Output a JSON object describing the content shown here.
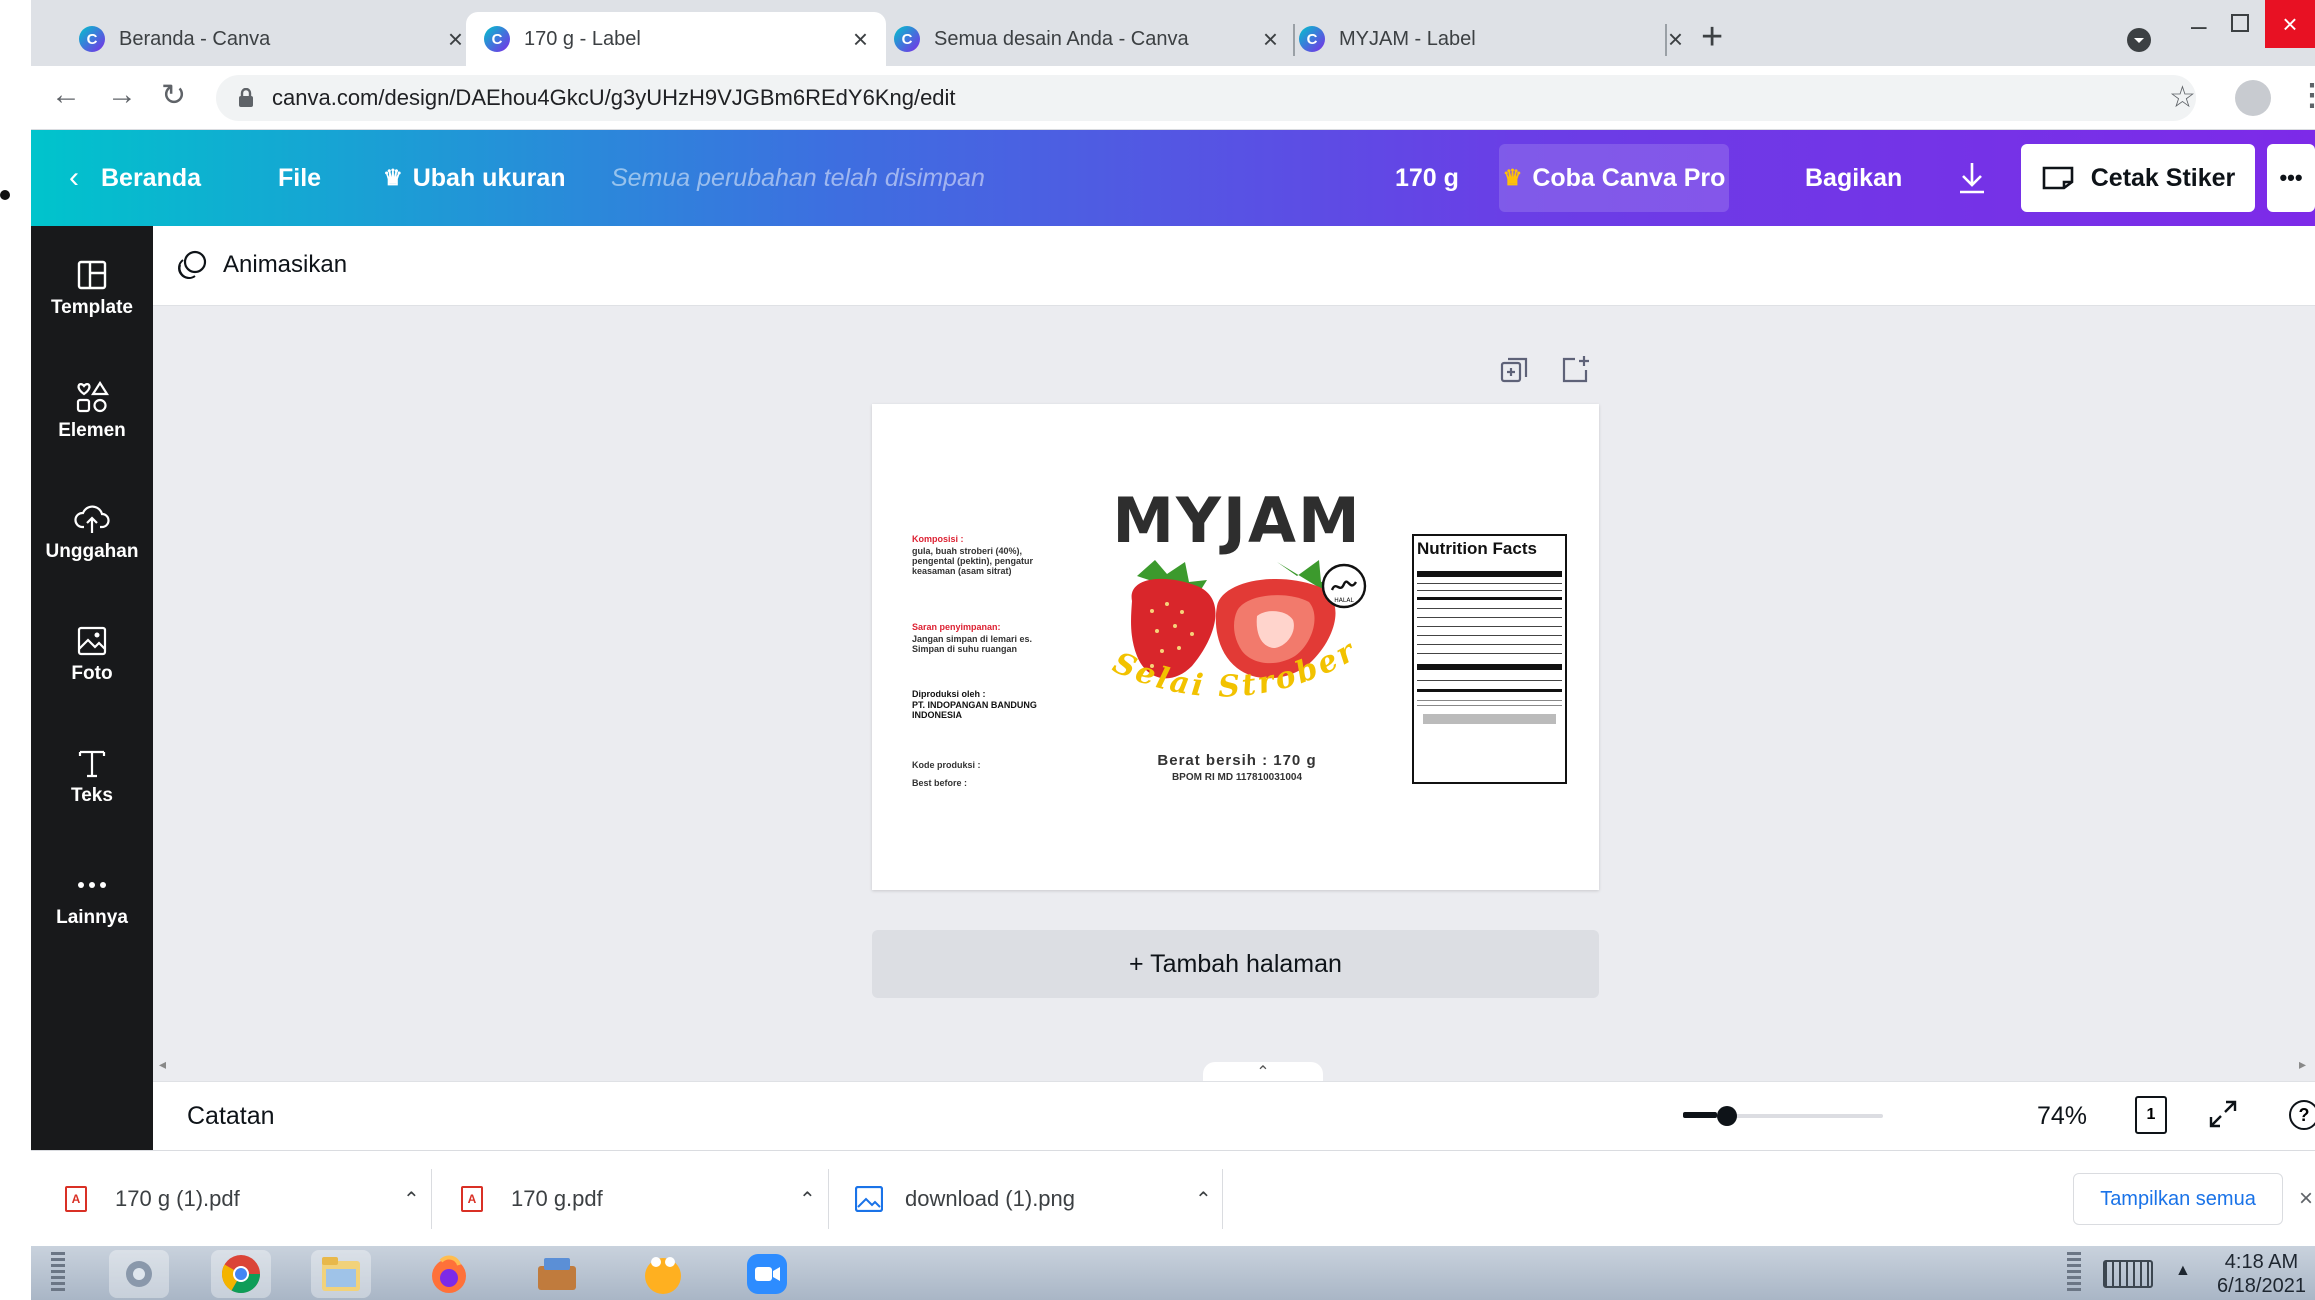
{
  "tabs": [
    {
      "title": "Beranda - Canva",
      "active": false
    },
    {
      "title": "170 g - Label",
      "active": true
    },
    {
      "title": "Semua desain Anda - Canva",
      "active": false
    },
    {
      "title": "MYJAM - Label",
      "active": false
    }
  ],
  "address": {
    "url": "canva.com/design/DAEhou4GkcU/g3yUHzH9VJGBm6REdY6Kng/edit"
  },
  "header": {
    "home": "Beranda",
    "file": "File",
    "resize": "Ubah ukuran",
    "saved_status": "Semua perubahan telah disimpan",
    "design_title": "170 g",
    "pro": "Coba Canva Pro",
    "share": "Bagikan",
    "print": "Cetak Stiker",
    "more": "•••"
  },
  "sidebar": {
    "items": [
      {
        "label": "Template"
      },
      {
        "label": "Elemen"
      },
      {
        "label": "Unggahan"
      },
      {
        "label": "Foto"
      },
      {
        "label": "Teks"
      },
      {
        "label": "Lainnya"
      }
    ]
  },
  "toolbar": {
    "animate": "Animasikan"
  },
  "label": {
    "brand": "MYJAM",
    "script_text": "Selai Strober",
    "composition_title": "Komposisi :",
    "composition_body": "gula, buah stroberi (40%), pengental (pektin), pengatur keasaman (asam sitrat)",
    "storage_title": "Saran penyimpanan:",
    "storage_body": "Jangan simpan di lemari es. Simpan di suhu ruangan",
    "producer_title": "Diproduksi oleh :",
    "producer_body": "PT. INDOPANGAN BANDUNG INDONESIA",
    "code": "Kode produksi :",
    "best_before": "Best before :",
    "net_weight": "Berat bersih : 170 g",
    "bpom": "BPOM RI MD 117810031004",
    "nutrition_title": "Nutrition Facts"
  },
  "editor": {
    "add_page": "+ Tambah halaman"
  },
  "bottom": {
    "notes": "Catatan",
    "zoom": "74%",
    "page_count": "1"
  },
  "downloads": {
    "items": [
      {
        "name": "170 g (1).pdf"
      },
      {
        "name": "170 g.pdf"
      },
      {
        "name": "download (1).png"
      }
    ],
    "show_all": "Tampilkan semua"
  },
  "clock": {
    "time": "4:18 AM",
    "date": "6/18/2021"
  },
  "colors": {
    "accent": "#7d2ae8",
    "teal": "#00c4cc",
    "sidebar": "#18191b",
    "strawberry": "#d9262b",
    "script_yellow": "#f2c200"
  }
}
